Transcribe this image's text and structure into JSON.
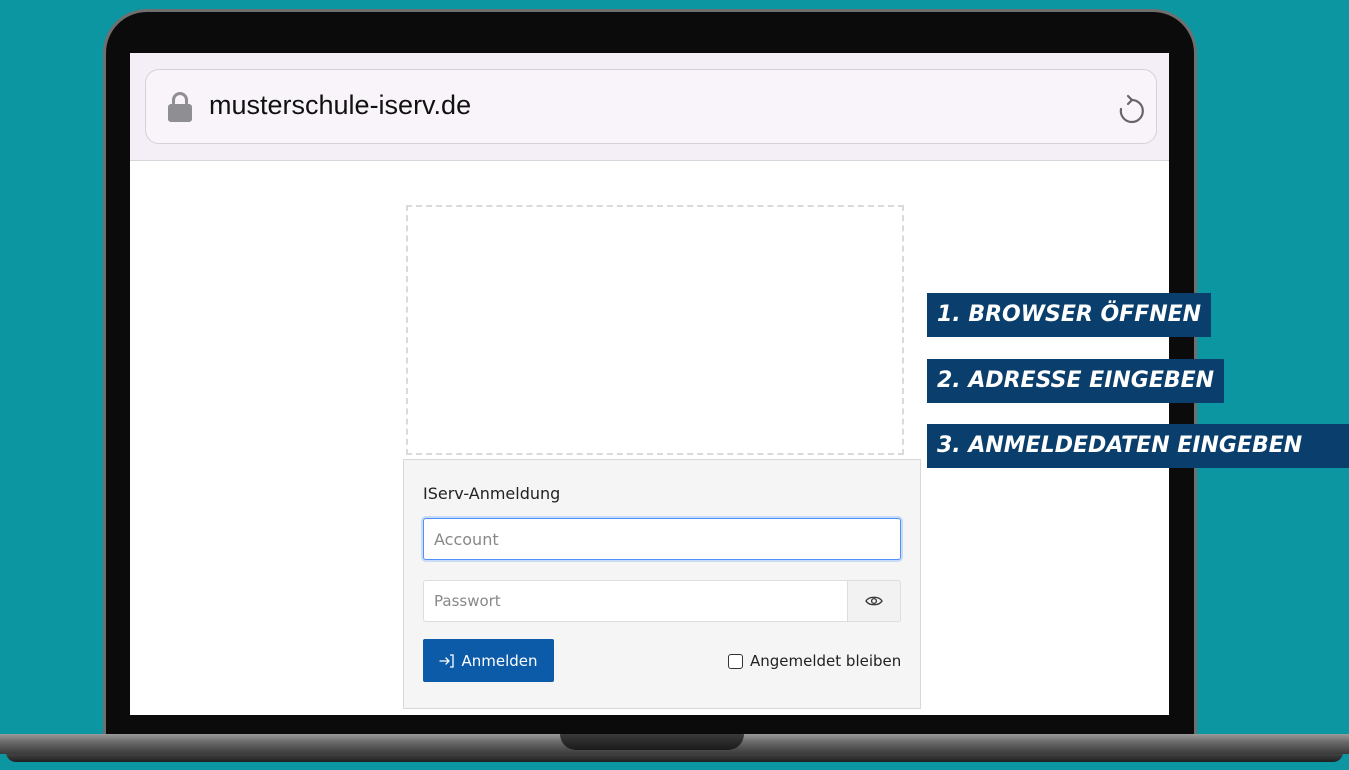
{
  "browser": {
    "url": "musterschule-iserv.de",
    "lock_icon": "lock-icon",
    "reload_icon": "reload-icon"
  },
  "login": {
    "title": "IServ-Anmeldung",
    "account_placeholder": "Account",
    "password_placeholder": "Passwort",
    "show_password_icon": "eye-icon",
    "submit_label": "Anmelden",
    "submit_icon": "login-arrow-icon",
    "remember_label": "Angemeldet bleiben"
  },
  "steps": [
    {
      "label": "1. BROWSER ÖFFNEN"
    },
    {
      "label": "2. ADRESSE EINGEBEN"
    },
    {
      "label": "3. ANMELDEDATEN EINGEBEN"
    }
  ],
  "colors": {
    "background": "#0b96a1",
    "step_badge": "#0a3f6d",
    "login_button": "#0c5ba8"
  }
}
